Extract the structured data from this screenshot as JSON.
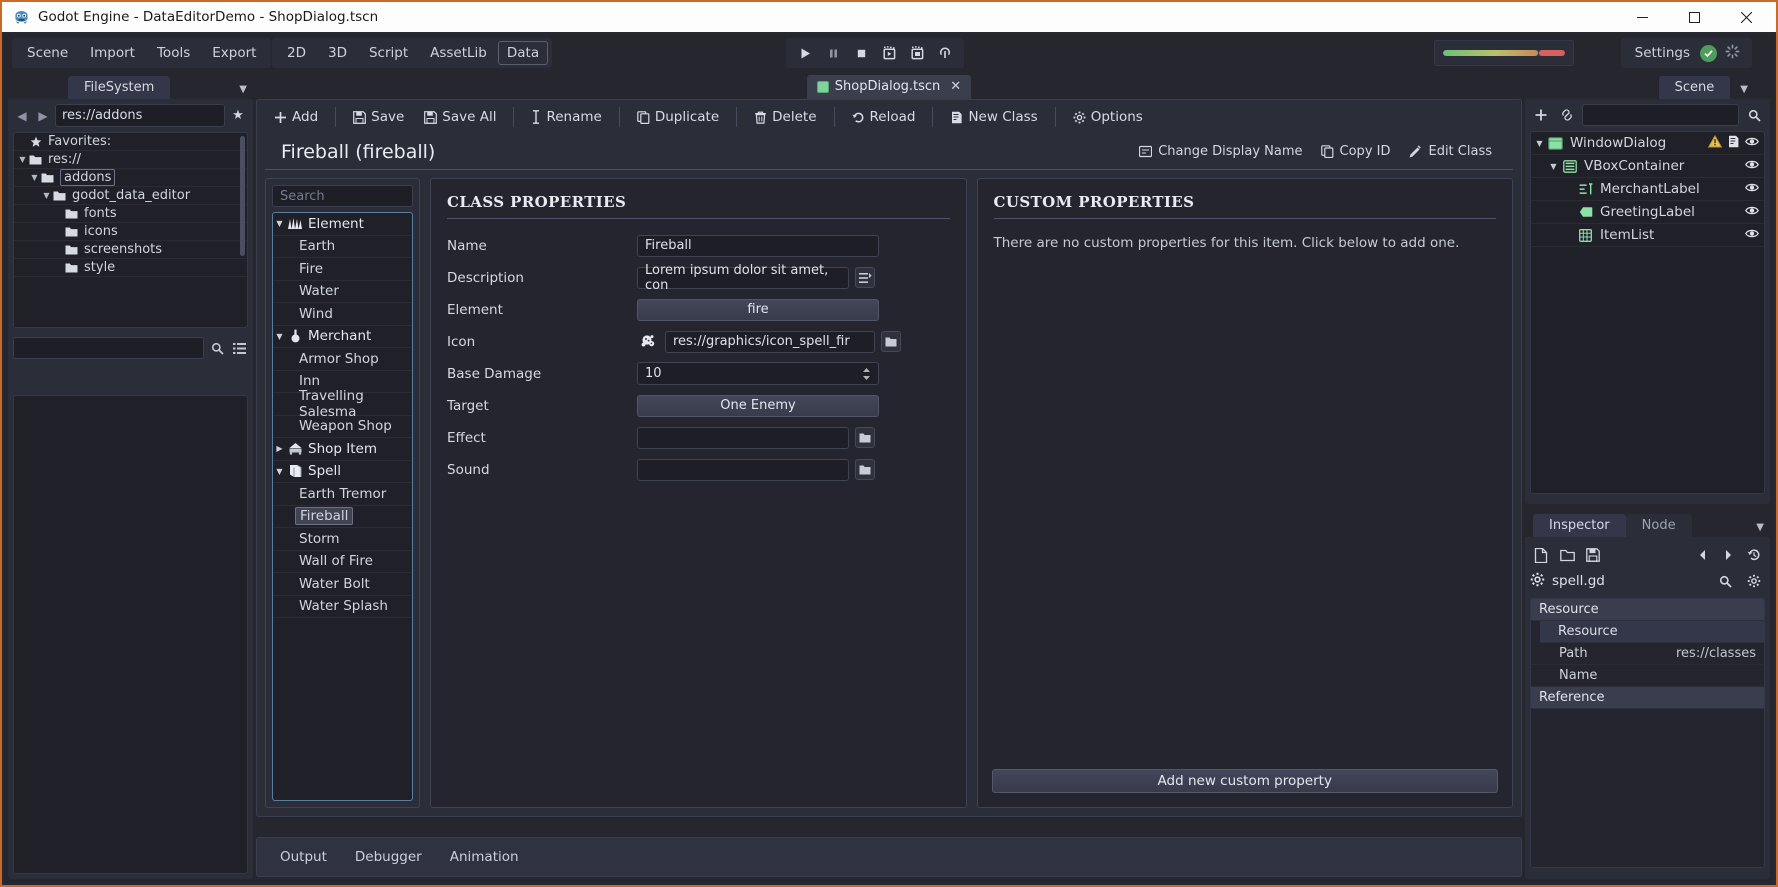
{
  "window": {
    "title": "Godot Engine - DataEditorDemo - ShopDialog.tscn",
    "icon": "godot-robot-icon",
    "minimize": "—",
    "maximize": "☐",
    "close": "✕"
  },
  "menubar": {
    "left_items": [
      {
        "label": "Scene",
        "name": "menu-scene"
      },
      {
        "label": "Import",
        "name": "menu-import"
      },
      {
        "label": "Tools",
        "name": "menu-tools"
      },
      {
        "label": "Export",
        "name": "menu-export"
      }
    ],
    "mode_items": [
      {
        "label": "2D",
        "name": "mode-2d",
        "active": false
      },
      {
        "label": "3D",
        "name": "mode-3d",
        "active": false
      },
      {
        "label": "Script",
        "name": "mode-script",
        "active": false
      },
      {
        "label": "AssetLib",
        "name": "mode-assetlib",
        "active": false
      },
      {
        "label": "Data",
        "name": "mode-data",
        "active": true
      }
    ],
    "play_buttons": [
      {
        "name": "play-icon",
        "glyph": "▶"
      },
      {
        "name": "pause-icon",
        "glyph": "❚❚"
      },
      {
        "name": "stop-icon",
        "glyph": "■"
      },
      {
        "name": "play-scene-icon",
        "glyph": "▷"
      },
      {
        "name": "play-custom-scene-icon",
        "glyph": "⧉"
      },
      {
        "name": "remote-debug-icon",
        "glyph": "♁"
      }
    ],
    "settings_label": "Settings",
    "settings_status_glyph": "✓"
  },
  "filesystem": {
    "tab_label": "FileSystem",
    "path_value": "res://addons",
    "back_glyph": "◀",
    "forward_glyph": "▶",
    "favorite_glyph": "★",
    "search_placeholder": "",
    "tree": [
      {
        "label": "Favorites:",
        "depth": 0,
        "kind": "favorites",
        "caret": "",
        "selected": false
      },
      {
        "label": "res://",
        "depth": 0,
        "kind": "folder",
        "caret": "▼",
        "selected": false
      },
      {
        "label": "addons",
        "depth": 1,
        "kind": "folder",
        "caret": "▼",
        "selected": true
      },
      {
        "label": "godot_data_editor",
        "depth": 2,
        "kind": "folder",
        "caret": "▼",
        "selected": false
      },
      {
        "label": "fonts",
        "depth": 3,
        "kind": "folder",
        "caret": "",
        "selected": false
      },
      {
        "label": "icons",
        "depth": 3,
        "kind": "folder",
        "caret": "",
        "selected": false
      },
      {
        "label": "screenshots",
        "depth": 3,
        "kind": "folder",
        "caret": "",
        "selected": false
      },
      {
        "label": "style",
        "depth": 3,
        "kind": "folder",
        "caret": "",
        "selected": false
      }
    ]
  },
  "scene_tab": {
    "label": "ShopDialog.tscn",
    "close_glyph": "✕"
  },
  "data_toolbar": [
    {
      "label": "Add",
      "icon": "plus-icon",
      "glyph": "＋",
      "name": "add-button"
    },
    {
      "label": "Save",
      "icon": "save-icon",
      "glyph": "💾",
      "name": "save-button"
    },
    {
      "label": "Save All",
      "icon": "save-all-icon",
      "glyph": "💾",
      "name": "save-all-button"
    },
    {
      "label": "Rename",
      "icon": "text-cursor-icon",
      "glyph": "I",
      "name": "rename-button"
    },
    {
      "label": "Duplicate",
      "icon": "duplicate-icon",
      "glyph": "❐",
      "name": "duplicate-button"
    },
    {
      "label": "Delete",
      "icon": "trash-icon",
      "glyph": "🗑",
      "name": "delete-button"
    },
    {
      "label": "Reload",
      "icon": "reload-icon",
      "glyph": "↺",
      "name": "reload-button"
    },
    {
      "label": "New Class",
      "icon": "new-class-icon",
      "glyph": "❐",
      "name": "new-class-button"
    },
    {
      "label": "Options",
      "icon": "gear-icon",
      "glyph": "⚙",
      "name": "options-button"
    }
  ],
  "class_header": {
    "title": "Fireball (fireball)",
    "actions": [
      {
        "label": "Change Display Name",
        "icon": "display-name-icon",
        "glyph": "⊞",
        "name": "change-display-name-button"
      },
      {
        "label": "Copy ID",
        "icon": "copy-icon",
        "glyph": "❐",
        "name": "copy-id-button"
      },
      {
        "label": "Edit Class",
        "icon": "pencil-icon",
        "glyph": "✎",
        "name": "edit-class-button"
      }
    ]
  },
  "class_list": {
    "search_placeholder": "Search",
    "items": [
      {
        "label": "Element",
        "type": "group",
        "caret": "▼",
        "icon": "element-icon",
        "selected": false
      },
      {
        "label": "Earth",
        "type": "child",
        "caret": "",
        "icon": "",
        "selected": false
      },
      {
        "label": "Fire",
        "type": "child",
        "caret": "",
        "icon": "",
        "selected": false
      },
      {
        "label": "Water",
        "type": "child",
        "caret": "",
        "icon": "",
        "selected": false
      },
      {
        "label": "Wind",
        "type": "child",
        "caret": "",
        "icon": "",
        "selected": false
      },
      {
        "label": "Merchant",
        "type": "group",
        "caret": "▼",
        "icon": "merchant-icon",
        "selected": false
      },
      {
        "label": "Armor Shop",
        "type": "child",
        "caret": "",
        "icon": "",
        "selected": false
      },
      {
        "label": "Inn",
        "type": "child",
        "caret": "",
        "icon": "",
        "selected": false
      },
      {
        "label": "Travelling Salesma",
        "type": "child",
        "caret": "",
        "icon": "",
        "selected": false
      },
      {
        "label": "Weapon Shop",
        "type": "child",
        "caret": "",
        "icon": "",
        "selected": false
      },
      {
        "label": "Shop Item",
        "type": "group",
        "caret": "▶",
        "icon": "shop-item-icon",
        "selected": false
      },
      {
        "label": "Spell",
        "type": "group",
        "caret": "▼",
        "icon": "spell-book-icon",
        "selected": false
      },
      {
        "label": "Earth Tremor",
        "type": "child",
        "caret": "",
        "icon": "",
        "selected": false
      },
      {
        "label": "Fireball",
        "type": "child",
        "caret": "",
        "icon": "",
        "selected": true
      },
      {
        "label": "Storm",
        "type": "child",
        "caret": "",
        "icon": "",
        "selected": false
      },
      {
        "label": "Wall of Fire",
        "type": "child",
        "caret": "",
        "icon": "",
        "selected": false
      },
      {
        "label": "Water Bolt",
        "type": "child",
        "caret": "",
        "icon": "",
        "selected": false
      },
      {
        "label": "Water Splash",
        "type": "child",
        "caret": "",
        "icon": "",
        "selected": false
      }
    ]
  },
  "class_properties": {
    "title": "CLASS PROPERTIES",
    "rows": [
      {
        "label": "Name",
        "kind": "text",
        "value": "Fireball",
        "name": "name-field"
      },
      {
        "label": "Description",
        "kind": "text-expand",
        "value": "Lorem ipsum dolor sit amet, con",
        "name": "description-field",
        "aux_icon": "expand-text-icon",
        "aux_glyph": "≣"
      },
      {
        "label": "Element",
        "kind": "option",
        "value": "fire",
        "name": "element-option"
      },
      {
        "label": "Icon",
        "kind": "resource",
        "value": "res://graphics/icon_spell_fir",
        "name": "icon-field",
        "aux_icon": "folder-icon",
        "aux_glyph": "📁",
        "preview_icon": "fireball-sprite-icon"
      },
      {
        "label": "Base Damage",
        "kind": "spin",
        "value": "10",
        "name": "base-damage-spinner"
      },
      {
        "label": "Target",
        "kind": "option",
        "value": "One Enemy",
        "name": "target-option"
      },
      {
        "label": "Effect",
        "kind": "resource",
        "value": "",
        "name": "effect-field",
        "aux_icon": "folder-icon",
        "aux_glyph": "📁"
      },
      {
        "label": "Sound",
        "kind": "resource",
        "value": "",
        "name": "sound-field",
        "aux_icon": "folder-icon",
        "aux_glyph": "📁"
      }
    ]
  },
  "custom_properties": {
    "title": "CUSTOM PROPERTIES",
    "empty_text": "There are no custom properties for this item. Click below to add one.",
    "add_button": "Add new custom property"
  },
  "scene_dock": {
    "tab_label": "Scene",
    "add_glyph": "＋",
    "link_glyph": "🔗",
    "search_glyph": "🔍",
    "caret_glyph": "▼",
    "nodes": [
      {
        "label": "WindowDialog",
        "depth": 0,
        "caret": "▼",
        "icon": "window-dialog-icon",
        "warning": true,
        "script": true,
        "visible_glyph": "◉"
      },
      {
        "label": "VBoxContainer",
        "depth": 1,
        "caret": "▼",
        "icon": "vbox-container-icon",
        "warning": false,
        "script": false,
        "visible_glyph": "◉"
      },
      {
        "label": "MerchantLabel",
        "depth": 2,
        "caret": "",
        "icon": "rich-text-label-icon",
        "warning": false,
        "script": false,
        "visible_glyph": "◉"
      },
      {
        "label": "GreetingLabel",
        "depth": 2,
        "caret": "",
        "icon": "label-icon",
        "warning": false,
        "script": false,
        "visible_glyph": "◉"
      },
      {
        "label": "ItemList",
        "depth": 2,
        "caret": "",
        "icon": "item-list-icon",
        "warning": false,
        "script": false,
        "visible_glyph": "◉"
      }
    ]
  },
  "inspector": {
    "tabs": [
      {
        "label": "Inspector",
        "active": true,
        "name": "tab-inspector"
      },
      {
        "label": "Node",
        "active": false,
        "name": "tab-node"
      }
    ],
    "caret_glyph": "▼",
    "toolbar": [
      {
        "name": "new-resource-icon",
        "glyph": "📄"
      },
      {
        "name": "open-resource-icon",
        "glyph": "📂"
      },
      {
        "name": "save-resource-icon",
        "glyph": "💾"
      },
      {
        "name": "history-prev-icon",
        "glyph": "◀"
      },
      {
        "name": "history-next-icon",
        "glyph": "▶"
      },
      {
        "name": "history-icon",
        "glyph": "↺"
      }
    ],
    "resource_icon": "gear-icon",
    "resource_name": "spell.gd",
    "search_glyph": "🔍",
    "options_glyph": "⚙",
    "properties": [
      {
        "kind": "category",
        "label": "Resource",
        "value": ""
      },
      {
        "kind": "subcategory",
        "label": "Resource",
        "value": ""
      },
      {
        "kind": "row",
        "label": "Path",
        "value": "res://classes"
      },
      {
        "kind": "row",
        "label": "Name",
        "value": ""
      },
      {
        "kind": "category",
        "label": "Reference",
        "value": ""
      }
    ]
  },
  "bottom_panel": {
    "tabs": [
      {
        "label": "Output",
        "name": "bottom-tab-output"
      },
      {
        "label": "Debugger",
        "name": "bottom-tab-debugger"
      },
      {
        "label": "Animation",
        "name": "bottom-tab-animation"
      }
    ]
  },
  "colors": {
    "accent_border": "#c96a2a",
    "panel": "#2b2d38",
    "dark": "#1f2028",
    "text": "#cfd2da",
    "green": "#7fd39a",
    "warning": "#e8c155"
  }
}
